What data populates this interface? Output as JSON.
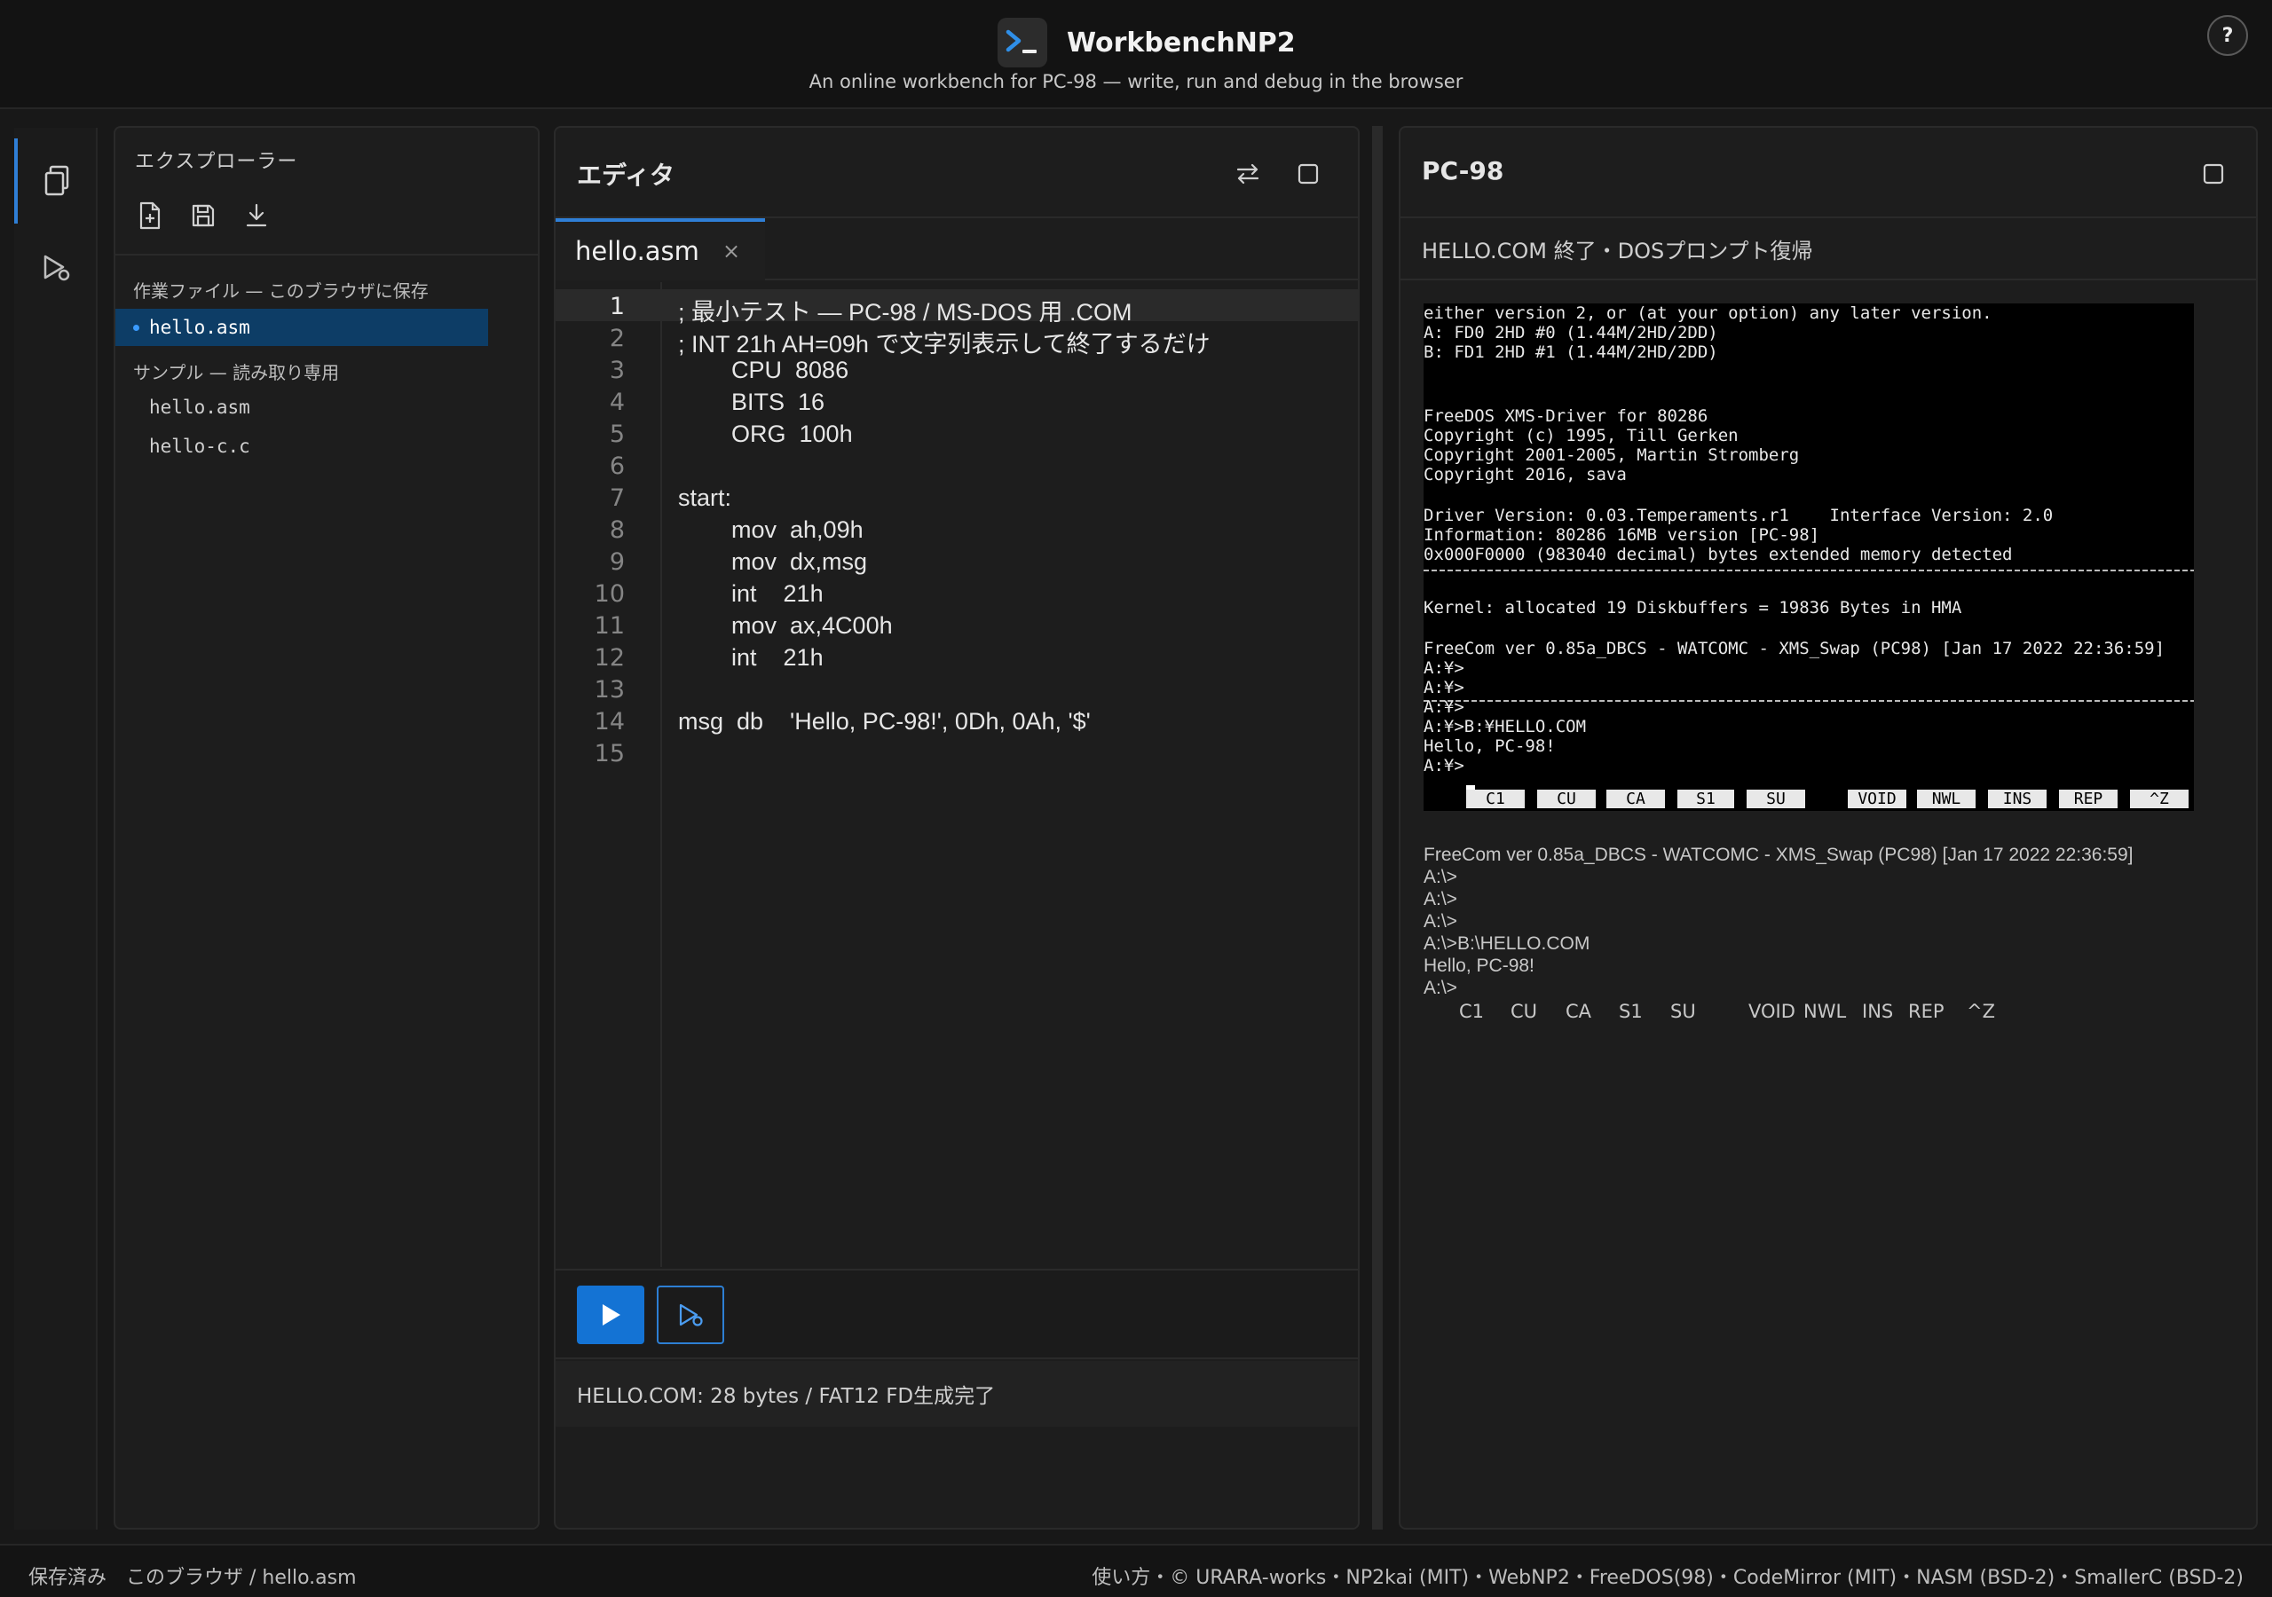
{
  "app": {
    "title": "WorkbenchNP2",
    "subtitle": "An online workbench for PC-98 — write, run and debug in the browser",
    "help_label": "?"
  },
  "explorer": {
    "title": "エクスプローラー",
    "tools": [
      "new-file-icon",
      "save-icon",
      "download-icon"
    ],
    "work_section": "作業ファイル — このブラウザに保存",
    "work_files": [
      "hello.asm"
    ],
    "sample_section": "サンプル — 読み取り専用",
    "sample_files": [
      "hello.asm",
      "hello-c.c"
    ]
  },
  "editor": {
    "title": "エディタ",
    "tab": "hello.asm",
    "tab_close": "×",
    "lines": [
      "; 最小テスト — PC-98 / MS-DOS 用 .COM",
      "; INT 21h AH=09h で文字列表示して終了するだけ",
      "        CPU  8086",
      "        BITS  16",
      "        ORG  100h",
      "",
      "start:",
      "        mov  ah,09h",
      "        mov  dx,msg",
      "        int    21h",
      "        mov  ax,4C00h",
      "        int    21h",
      "",
      "msg  db    'Hello, PC-98!', 0Dh, 0Ah, '$'",
      ""
    ],
    "line_numbers": [
      "1",
      "2",
      "3",
      "4",
      "5",
      "6",
      "7",
      "8",
      "9",
      "10",
      "11",
      "12",
      "13",
      "14",
      "15"
    ],
    "current_line": 1,
    "status": "HELLO.COM: 28 bytes / FAT12 FD生成完了"
  },
  "pc98": {
    "title": "PC-98",
    "status": "HELLO.COM 終了・DOSプロンプト復帰",
    "screen_lines": [
      "either version 2, or (at your option) any later version.",
      "A: FD0 2HD #0 (1.44M/2HD/2DD)",
      "B: FD1 2HD #1 (1.44M/2HD/2DD)",
      "FreeDOS XMS-Driver for 80286",
      "Copyright (c) 1995, Till Gerken",
      "Copyright 2001-2005, Martin Stromberg",
      "Copyright 2016, sava",
      "Driver Version: 0.03.Temperaments.r1    Interface Version: 2.0",
      "Information: 80286 16MB version [PC-98]",
      "0x000F0000 (983040 decimal) bytes extended memory detected",
      "Kernel: allocated 19 Diskbuffers = 19836 Bytes in HMA",
      "FreeCom ver 0.85a_DBCS - WATCOMC - XMS_Swap (PC98) [Jan 17 2022 22:36:59]",
      "A:¥>",
      "A:¥>",
      "A:¥>",
      "A:¥>B:¥HELLO.COM",
      "Hello, PC-98!",
      "A:¥>"
    ],
    "fkeys": [
      "C1",
      "CU",
      "CA",
      "S1",
      "SU",
      "VOID",
      "NWL",
      "INS",
      "REP",
      "^Z"
    ],
    "text_lines": [
      "FreeCom ver 0.85a_DBCS - WATCOMC - XMS_Swap (PC98) [Jan 17 2022 22:36:59]",
      "A:\\>",
      "A:\\>",
      "A:\\>",
      "A:\\>B:\\HELLO.COM",
      "Hello, PC-98!",
      "A:\\>"
    ]
  },
  "footer": {
    "left": "保存済み　このブラウザ / hello.asm",
    "right": "使い方・© URARA-works・NP2kai (MIT)・WebNP2・FreeDOS(98)・CodeMirror (MIT)・NASM (BSD-2)・SmallerC (BSD-2)"
  },
  "colors": {
    "accent": "#1473d4",
    "selection": "#0d3d66",
    "background": "#181818"
  }
}
